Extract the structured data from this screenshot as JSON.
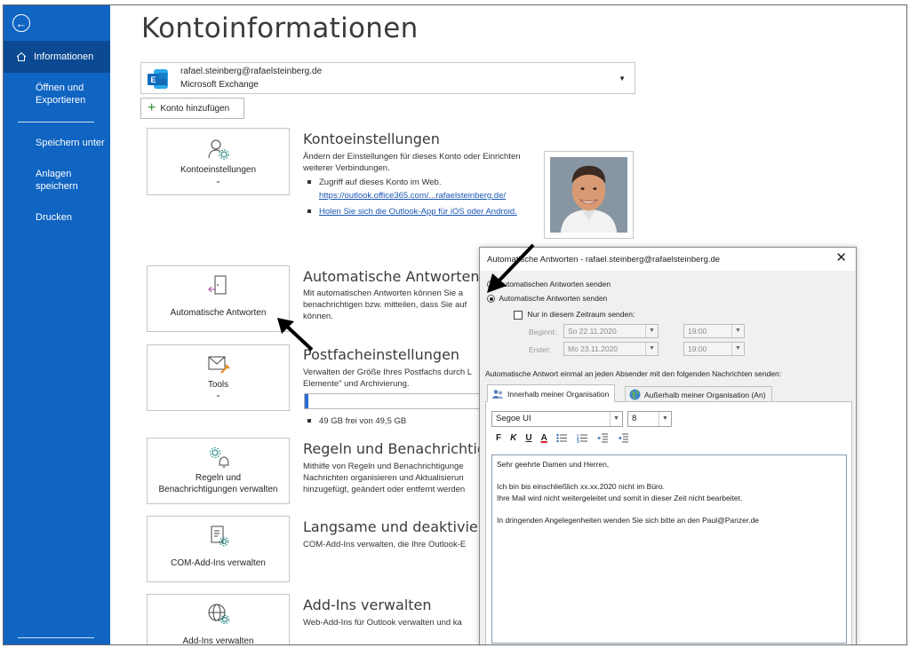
{
  "sidebar": {
    "back_label": "",
    "items": [
      {
        "label": "Informationen",
        "active": true
      },
      {
        "label": "Öffnen und Exportieren"
      },
      {
        "label": "Speichern unter"
      },
      {
        "label": "Anlagen speichern"
      },
      {
        "label": "Drucken"
      }
    ]
  },
  "main": {
    "title": "Kontoinformationen",
    "account": {
      "email": "rafael.steinberg@rafaelsteinberg.de",
      "type": "Microsoft Exchange"
    },
    "add_account_label": "Konto hinzufügen",
    "tiles": {
      "account_settings": "Kontoeinstellungen",
      "auto_replies": "Automatische Antworten",
      "tools": "Tools",
      "rules_line1": "Regeln und",
      "rules_line2": "Benachrichtigungen verwalten",
      "com_addins": "COM-Add-Ins verwalten",
      "addins": "Add-Ins verwalten"
    },
    "sections": {
      "account": {
        "title": "Kontoeinstellungen",
        "text": "Ändern der Einstellungen für dieses Konto oder Einrichten weiterer Verbindungen.",
        "bullet1": "Zugriff auf dieses Konto im Web.",
        "bullet1_link": "https://outlook.office365.com/...rafaelsteinberg.de/",
        "bullet2_link": "Holen Sie sich die Outlook-App für iOS oder Android."
      },
      "auto": {
        "title": "Automatische Antworten (Au",
        "line1": "Mit automatischen Antworten können Sie a",
        "line2": "benachrichtigen bzw. mitteilen, dass Sie auf",
        "line3": "können."
      },
      "mailbox": {
        "title": "Postfacheinstellungen",
        "line1": "Verwalten der Größe Ihres Postfachs durch L",
        "line2": "Elemente\" und Archivierung.",
        "storage_text": "49 GB frei von 49,5 GB",
        "storage_used_fraction": 0.01
      },
      "rules": {
        "title": "Regeln und Benachrichtigunc",
        "line1": "Mithilfe von Regeln und Benachrichtigunge",
        "line2": "Nachrichten organisieren und Aktualisierun",
        "line3": "hinzugefügt, geändert oder entfernt werden"
      },
      "com": {
        "title": "Langsame und deaktivierte (",
        "line1": "COM-Add-Ins verwalten, die Ihre Outlook-E"
      },
      "addins": {
        "title": "Add-Ins verwalten",
        "line1": "Web-Add-Ins für Outlook verwalten und ka"
      }
    }
  },
  "dialog": {
    "title": "Automatische Antworten - rafael.steinberg@rafaelsteinberg.de",
    "close": "✕",
    "radio_off": "automatischen Antworten senden",
    "radio_on": "Automatische Antworten senden",
    "period_check": "Nur in diesem Zeitraum senden:",
    "start_label": "Beginnt:",
    "start_date": "So 22.11.2020",
    "start_time": "19:00",
    "end_label": "Endet:",
    "end_date": "Mo 23.11.2020",
    "end_time": "19:00",
    "send_once": "Automatische Antwort einmal an jeden Absender mit den folgenden Nachrichten senden:",
    "tab_inside": "Innerhalb meiner Organisation",
    "tab_outside": "Außerhalb meiner Organisation (An)",
    "font": "Segoe UI",
    "size": "8",
    "fmt": [
      "F",
      "K",
      "U",
      "A"
    ],
    "message": {
      "l1": "Sehr geehrte Damen und Herren,",
      "l2": "Ich bin bis einschließlich xx.xx.2020 nicht im Büro.",
      "l3": "Ihre Mail wird nicht weitergeleitet und somit in dieser Zeit nicht bearbeitet.",
      "l4": "In dringenden Angelegenheiten wenden Sie sich bitte an den Paul@Panzer.de"
    }
  },
  "colors": {
    "sidebar": "#1064c2",
    "sidebar_active": "#0b4a92",
    "link": "#1a56b4",
    "exchange": "#0f6cbd"
  }
}
